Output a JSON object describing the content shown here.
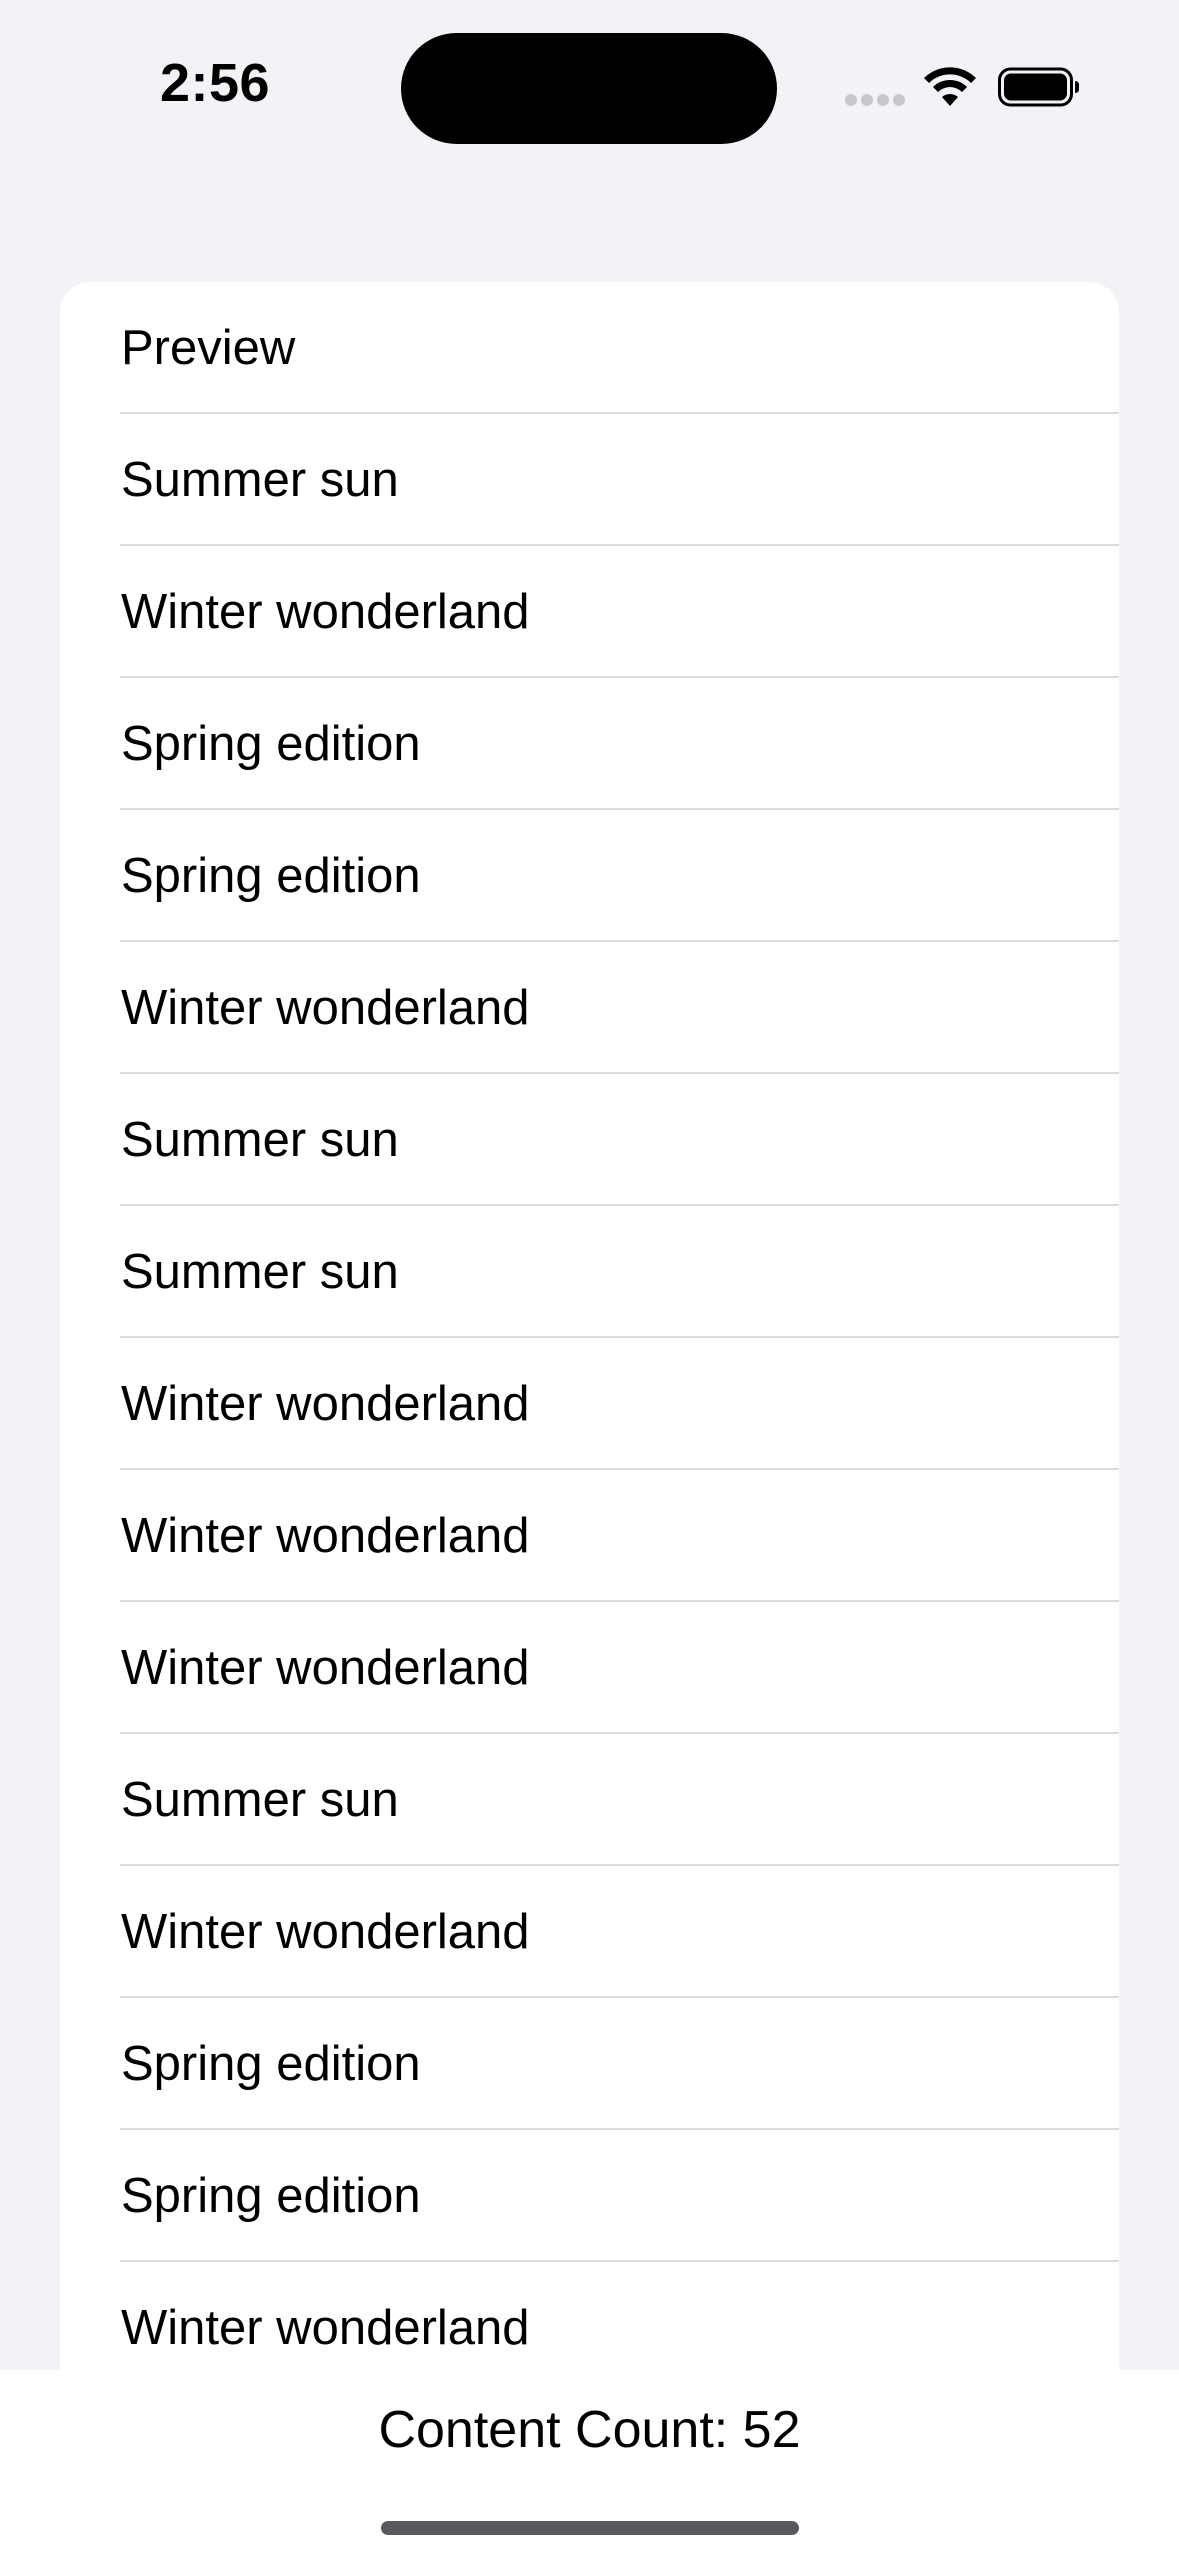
{
  "status_bar": {
    "time": "2:56"
  },
  "list": {
    "items": [
      {
        "label": "Preview"
      },
      {
        "label": "Summer sun"
      },
      {
        "label": "Winter wonderland"
      },
      {
        "label": "Spring edition"
      },
      {
        "label": "Spring edition"
      },
      {
        "label": "Winter wonderland"
      },
      {
        "label": "Summer sun"
      },
      {
        "label": "Summer sun"
      },
      {
        "label": "Winter wonderland"
      },
      {
        "label": "Winter wonderland"
      },
      {
        "label": "Winter wonderland"
      },
      {
        "label": "Summer sun"
      },
      {
        "label": "Winter wonderland"
      },
      {
        "label": "Spring edition"
      },
      {
        "label": "Spring edition"
      },
      {
        "label": "Winter wonderland"
      }
    ]
  },
  "footer": {
    "content_count": "Content Count: 52"
  }
}
